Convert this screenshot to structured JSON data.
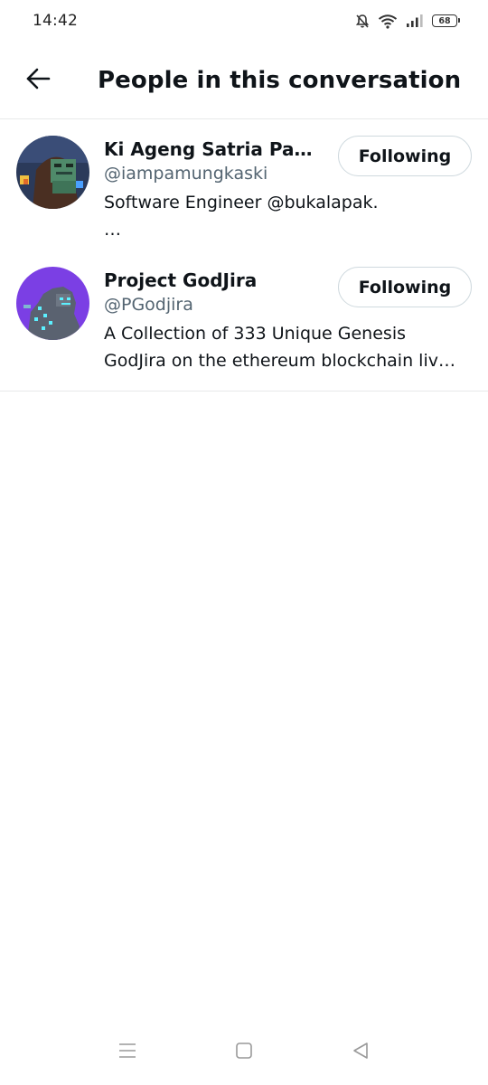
{
  "status_bar": {
    "time": "14:42",
    "battery_level": "68",
    "icons": [
      "mute-bell-icon",
      "wifi-icon",
      "signal-icon",
      "battery-icon"
    ]
  },
  "header": {
    "title": "People in this conversation",
    "back_icon": "arrow-left-icon"
  },
  "people": [
    {
      "display_name": "Ki Ageng Satria Pamu…",
      "handle": "@iampamungkaski",
      "follow_label": "Following",
      "bio": "Software Engineer @bukalapak.\n…"
    },
    {
      "display_name": "Project GodJira",
      "handle": "@PGodjira",
      "follow_label": "Following",
      "bio": "A Collection of 333 Unique Genesis\nGodJira on the ethereum blockchain liv…"
    }
  ],
  "nav_bar": {
    "icons": [
      "menu-icon",
      "home-square-icon",
      "back-triangle-icon"
    ]
  },
  "colors": {
    "text_primary": "#0f1419",
    "text_secondary": "#536471",
    "divider": "#e7e9ea",
    "button_border": "#cfd9de"
  }
}
